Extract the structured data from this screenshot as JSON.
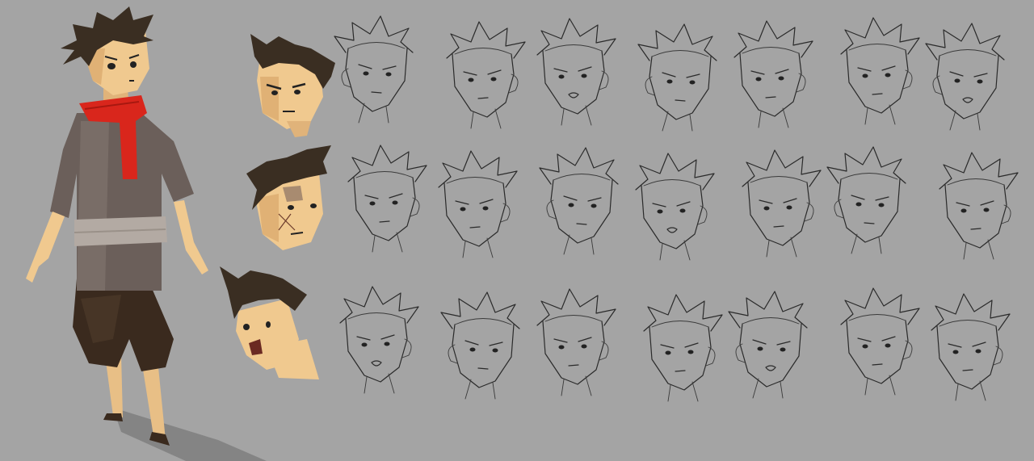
{
  "artwork": {
    "colors": {
      "background": "#a4a4a4",
      "skin": "#f0c98f",
      "skin_shadow": "#c98f55",
      "hair": "#3a2e22",
      "scarf": "#d9261c",
      "tunic": "#6b5f5a",
      "sash": "#b3aaa3",
      "trousers": "#3a2a1e",
      "shadow": "#7c7c7c",
      "line": "#2a2a2a"
    },
    "sketch_rows": 3,
    "sketch_heads_per_row": 7,
    "colored_heads": 3
  }
}
